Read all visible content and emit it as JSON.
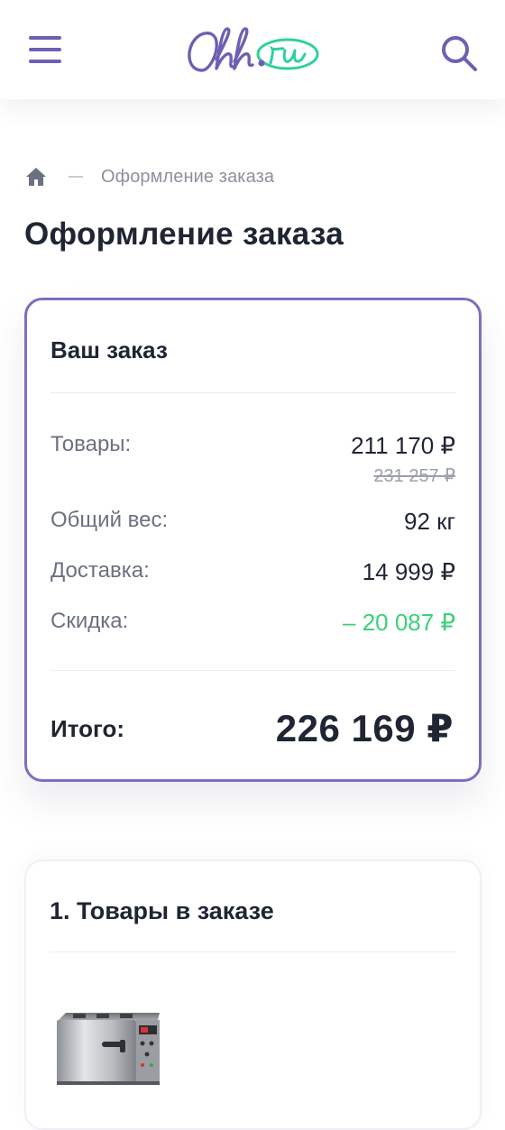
{
  "header": {
    "logo_text": "Ohh.ru",
    "menu_icon": "hamburger-menu-icon",
    "search_icon": "search-icon",
    "accent_color": "#6f5fb4",
    "logo_accent_color": "#2fcfa0"
  },
  "breadcrumb": {
    "home_icon": "home-icon",
    "current": "Оформление заказа"
  },
  "page_title": "Оформление заказа",
  "summary": {
    "title": "Ваш заказ",
    "goods_label": "Товары:",
    "goods_value": "211 170 ₽",
    "goods_old_value": "231 257 ₽",
    "weight_label": "Общий вес:",
    "weight_value": "92 кг",
    "delivery_label": "Доставка:",
    "delivery_value": "14 999 ₽",
    "discount_label": "Скидка:",
    "discount_value": "– 20 087 ₽",
    "discount_color": "#3dd07a",
    "total_label": "Итого:",
    "total_value": "226 169 ₽",
    "border_color": "#7d6fbf"
  },
  "items_section": {
    "title": "1. Товары в заказе",
    "product_image": "product-oven-image"
  }
}
